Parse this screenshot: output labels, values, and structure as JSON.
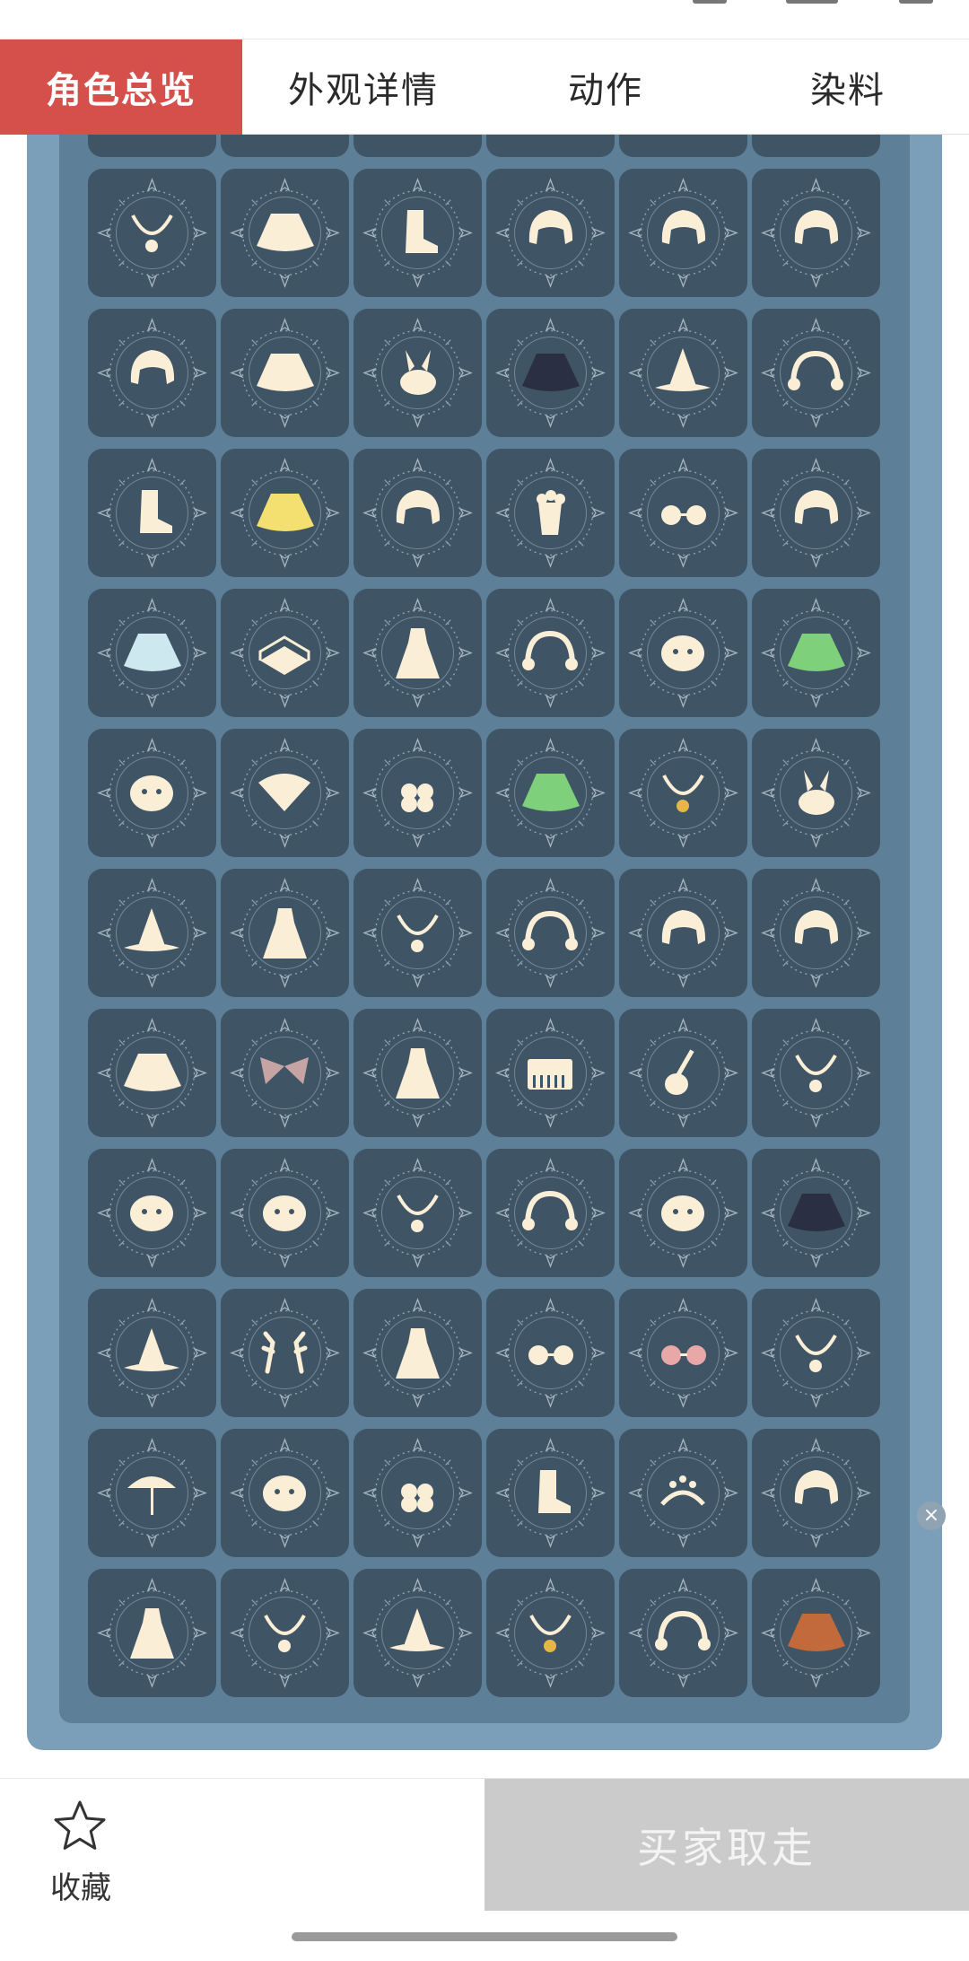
{
  "tabs": [
    {
      "label": "角色总览",
      "active": true
    },
    {
      "label": "外观详情",
      "active": false
    },
    {
      "label": "动作",
      "active": false
    },
    {
      "label": "染料",
      "active": false
    }
  ],
  "colors": {
    "accent": "#d5504a",
    "panel_outer": "#7c9fb9",
    "panel_inner": "#5e7f98",
    "tile_bg": "#3f5566",
    "icon_cream": "#fbeed6"
  },
  "items": [
    [
      "necklace-bow-icon",
      "scarf-icon",
      "boot-icon",
      "hair-bun-icon",
      "short-hair-icon",
      "blue-hair-bow-icon"
    ],
    [
      "ponytail-hair-icon",
      "long-cape-icon",
      "rabbit-flower-icon",
      "dark-cape-icon",
      "horn-hat-icon",
      "earmuff-icon"
    ],
    [
      "snow-boot-icon",
      "yellow-cape-icon",
      "blob-hair-icon",
      "popcorn-icon",
      "3d-glasses-icon",
      "curly-hair-icon"
    ],
    [
      "blue-cape-icon",
      "pizza-box-icon",
      "robe-dress-icon",
      "ear-headband-icon",
      "cat-mask-icon",
      "green-cape-icon"
    ],
    [
      "round-mask-icon",
      "folding-fan-icon",
      "flower-clip-icon",
      "green-shell-cape-icon",
      "yellow-tie-icon",
      "fox-plush-icon"
    ],
    [
      "dog-ears-hat-icon",
      "monk-robe-icon",
      "pendant-necklace-icon",
      "headphones-icon",
      "beret-hair-icon",
      "wavy-hair-icon"
    ],
    [
      "turtle-cape-icon",
      "bat-wings-icon",
      "tiered-dress-icon",
      "piano-icon",
      "guitar-icon",
      "earring-icon"
    ],
    [
      "pig-mask-icon",
      "cat-face-icon",
      "long-earring-icon",
      "cat-ear-headband-icon",
      "pumpkin-mask-icon",
      "dark-bat-cape-icon"
    ],
    [
      "witch-hat-icon",
      "antlers-icon",
      "kimono-icon",
      "round-glasses-icon",
      "heart-glasses-icon",
      "chain-necklace-icon"
    ],
    [
      "parasol-icon",
      "whale-mask-icon",
      "apple-icon",
      "sneaker-icon",
      "star-moon-crown-icon",
      "bob-hair-icon"
    ],
    [
      "ribbon-dress-icon",
      "flower-necklace-icon",
      "sun-hat-icon",
      "gold-pendant-icon",
      "bear-plush-icon",
      "orange-bat-cape-icon"
    ]
  ],
  "footer": {
    "favorite_label": "收藏",
    "buy_label": "买家取走"
  }
}
